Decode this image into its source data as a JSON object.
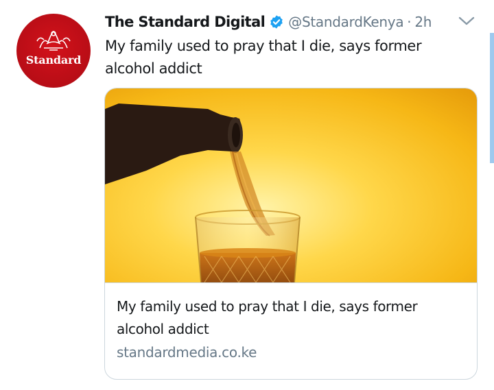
{
  "tweet": {
    "display_name": "The Standard Digital",
    "handle": "@StandardKenya",
    "separator": "·",
    "time": "2h",
    "text": "My family used to pray that I die, says former alcohol addict",
    "avatar": {
      "brand_text": "Standard",
      "color": "#c8101a"
    },
    "icons": {
      "verified": "verified-badge-icon",
      "menu": "chevron-down-icon"
    },
    "accent_color": "#1da1f2"
  },
  "card": {
    "title": "My family used to pray that I die, says former alcohol addict",
    "domain": "standardmedia.co.ke",
    "image": "whisky-pour-photo"
  }
}
